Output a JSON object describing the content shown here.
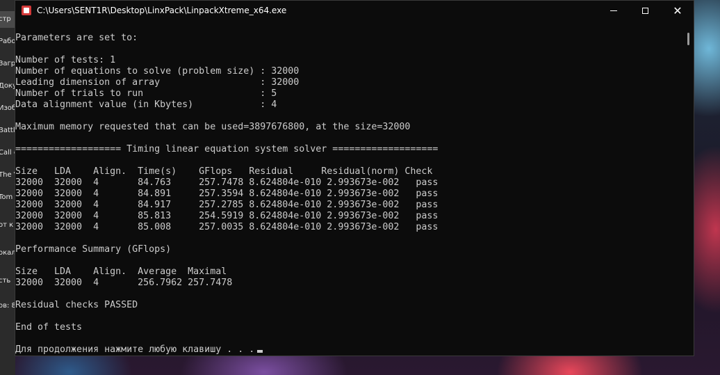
{
  "window": {
    "title": "C:\\Users\\SENT1R\\Desktop\\LinxPack\\LinpackXtreme_x64.exe",
    "buttons": {
      "minimize": "—",
      "maximize": "☐",
      "close": "✕"
    }
  },
  "left_panel": {
    "items": [
      {
        "label": "стр",
        "active": true
      },
      {
        "label": "Рабо"
      },
      {
        "label": "Загр"
      },
      {
        "label": "Доку"
      },
      {
        "label": "Изоб"
      },
      {
        "label": "Battl"
      },
      {
        "label": "Call c"
      },
      {
        "label": "The V"
      },
      {
        "label": "Tom"
      },
      {
        "label": "от к"
      },
      {
        "label": "окал"
      },
      {
        "label": "сть"
      },
      {
        "label": "ов: 8"
      }
    ]
  },
  "terminal": {
    "lines": [
      "Parameters are set to:",
      "",
      "Number of tests: 1",
      "Number of equations to solve (problem size) : 32000",
      "Leading dimension of array                  : 32000",
      "Number of trials to run                     : 5",
      "Data alignment value (in Kbytes)            : 4",
      "",
      "Maximum memory requested that can be used=3897676800, at the size=32000",
      "",
      "=================== Timing linear equation system solver ===================",
      "",
      "Size   LDA    Align.  Time(s)    GFlops   Residual     Residual(norm) Check",
      "32000  32000  4       84.763     257.7478 8.624804e-010 2.993673e-002   pass",
      "32000  32000  4       84.891     257.3594 8.624804e-010 2.993673e-002   pass",
      "32000  32000  4       84.917     257.2785 8.624804e-010 2.993673e-002   pass",
      "32000  32000  4       85.813     254.5919 8.624804e-010 2.993673e-002   pass",
      "32000  32000  4       85.008     257.0035 8.624804e-010 2.993673e-002   pass",
      "",
      "Performance Summary (GFlops)",
      "",
      "Size   LDA    Align.  Average  Maximal",
      "32000  32000  4       256.7962 257.7478",
      "",
      "Residual checks PASSED",
      "",
      "End of tests",
      ""
    ],
    "prompt": "Для продолжения нажмите любую клавишу . . ."
  }
}
